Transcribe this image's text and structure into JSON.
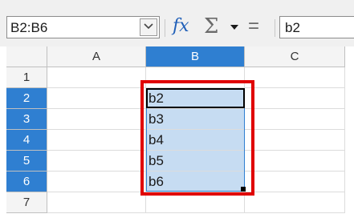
{
  "formula_bar": {
    "name_box": "B2:B6",
    "fx_icon": "fx",
    "sum_icon": "Σ",
    "equals_icon": "=",
    "input_value": "b2"
  },
  "columns": [
    "A",
    "B",
    "C"
  ],
  "rows": [
    "1",
    "2",
    "3",
    "4",
    "5",
    "6",
    "7"
  ],
  "cells": {
    "B2": "b2",
    "B3": "b3",
    "B4": "b4",
    "B5": "b5",
    "B6": "b6"
  },
  "colors": {
    "selection_header": "#2f7fd1",
    "selection_fill": "#c6dcf2",
    "highlight_border": "#e00000"
  }
}
